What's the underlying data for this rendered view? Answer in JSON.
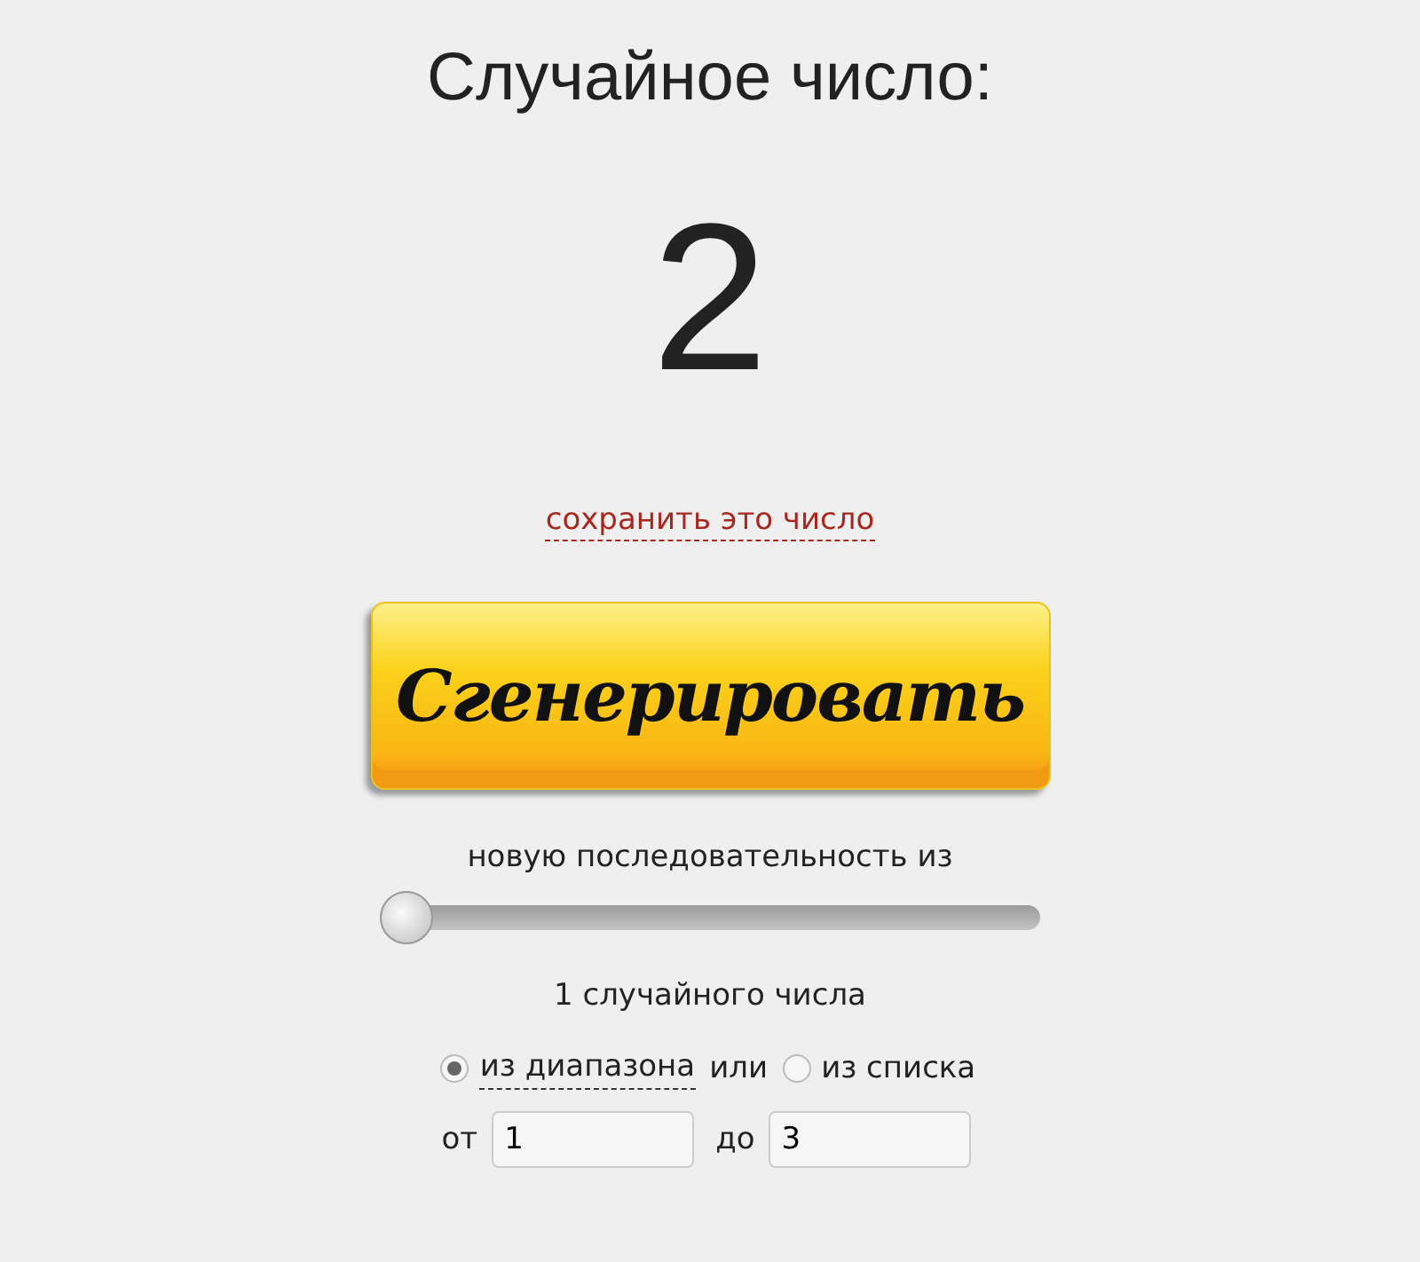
{
  "title": "Случайное число:",
  "result": "2",
  "save_link": "сохранить это число",
  "generate_button": "Сгенерировать",
  "sequence_label": "новую последовательность из",
  "count_slider": {
    "level": 0
  },
  "count_label": "1 случайного числа",
  "sources": [
    {
      "label": "из диапазона",
      "selected": true
    },
    {
      "label": "из списка",
      "selected": false
    }
  ],
  "sources_separator": "или",
  "range": {
    "from_label": "от",
    "from_value": "1",
    "to_label": "до",
    "to_value": "3"
  }
}
